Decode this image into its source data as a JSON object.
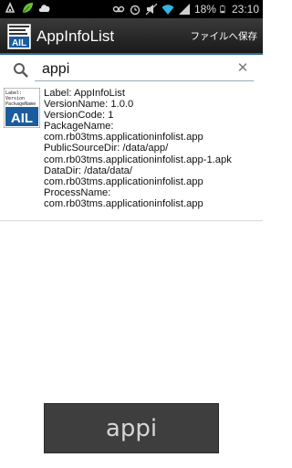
{
  "status_bar": {
    "battery_percent": "18%",
    "time": "23:10",
    "icons": [
      "usb-debug-icon",
      "leaf-icon",
      "cloud-icon",
      "voicemail-icon",
      "alarm-icon",
      "silent-icon",
      "wifi-icon",
      "signal-icon",
      "battery-icon"
    ]
  },
  "action_bar": {
    "title": "AppInfoList",
    "save_label": "ファイルへ保存",
    "accent_color": "#2b6e95"
  },
  "search": {
    "query": "appi"
  },
  "results": [
    {
      "icon_lines": [
        "Label:",
        "Version",
        "PackageName"
      ],
      "icon_badge": "AIL",
      "lines": [
        "Label: AppInfoList",
        "VersionName: 1.0.0",
        "VersionCode: 1",
        "PackageName:",
        "com.rb03tms.applicationinfolist.app",
        "PublicSourceDir: /data/app/",
        "com.rb03tms.applicationinfolist.app-1.apk",
        "DataDir: /data/data/",
        "com.rb03tms.applicationinfolist.app",
        "ProcessName:",
        "com.rb03tms.applicationinfolist.app"
      ]
    }
  ],
  "bottom_button": {
    "label": "appi"
  }
}
